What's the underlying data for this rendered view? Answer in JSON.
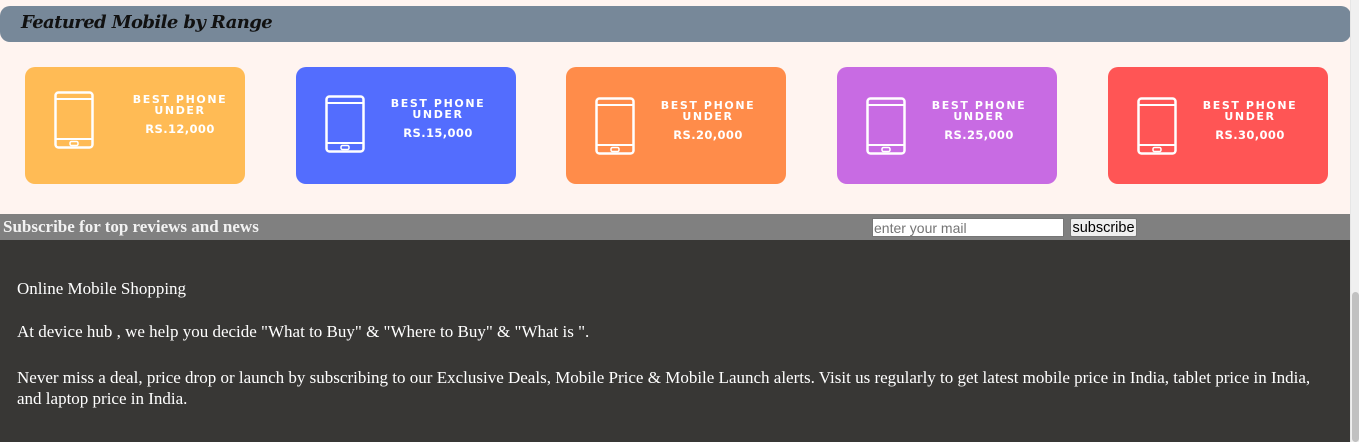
{
  "featured": {
    "title": "Featured Mobile by Range",
    "cards": [
      {
        "line1": "BEST PHONE",
        "line2": "UNDER",
        "price": "RS.12,000",
        "color": "#ffbb55",
        "icon": "smartphone-icon"
      },
      {
        "line1": "BEST PHONE",
        "line2": "UNDER",
        "price": "RS.15,000",
        "color": "#536dfe",
        "icon": "smartphone-icon"
      },
      {
        "line1": "BEST PHONE",
        "line2": "UNDER",
        "price": "RS.20,000",
        "color": "#ff8c4a",
        "icon": "smartphone-icon"
      },
      {
        "line1": "BEST PHONE",
        "line2": "UNDER",
        "price": "RS.25,000",
        "color": "#c86be3",
        "icon": "smartphone-icon"
      },
      {
        "line1": "BEST PHONE",
        "line2": "UNDER",
        "price": "RS.30,000",
        "color": "#ff5555",
        "icon": "smartphone-icon"
      }
    ]
  },
  "subscribe": {
    "title": "Subscribe for top reviews and news",
    "placeholder": "enter your mail",
    "button_label": "subscribe"
  },
  "footer": {
    "heading": "Online Mobile Shopping",
    "para1": "At device hub , we help you decide \"What to Buy\" & \"Where to Buy\" & \"What is \".",
    "para2": "Never miss a deal, price drop or launch by subscribing to our Exclusive Deals, Mobile Price & Mobile Launch alerts. Visit us regularly to get latest mobile price in India, tablet price in India, and laptop price in India."
  },
  "colors": {
    "header_bg": "#778899",
    "page_bg": "#fff4f0",
    "subscribe_bg": "#808080",
    "footer_bg": "#383735"
  }
}
